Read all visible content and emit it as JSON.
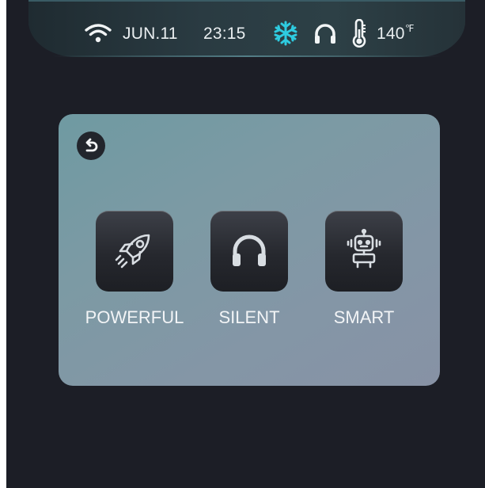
{
  "status_bar": {
    "date": "JUN.11",
    "time": "23:15",
    "temperature": "140",
    "temperature_unit": "℉",
    "wifi_icon": "wifi-icon",
    "mode_icon": "snowflake-icon",
    "audio_icon": "headphones-icon",
    "temp_icon": "thermometer-icon",
    "mode_icon_color": "#2ecbe0"
  },
  "mode_panel": {
    "back_icon": "back-arrow-icon",
    "options": [
      {
        "label": "POWERFUL",
        "icon": "rocket-icon"
      },
      {
        "label": "SILENT",
        "icon": "headphones-icon"
      },
      {
        "label": "SMART",
        "icon": "robot-icon"
      }
    ]
  },
  "colors": {
    "screen_background": "#1c1e26",
    "panel_background": "#7b99a3",
    "tile_background": "#2b2d33",
    "text": "#f2f4f6"
  }
}
